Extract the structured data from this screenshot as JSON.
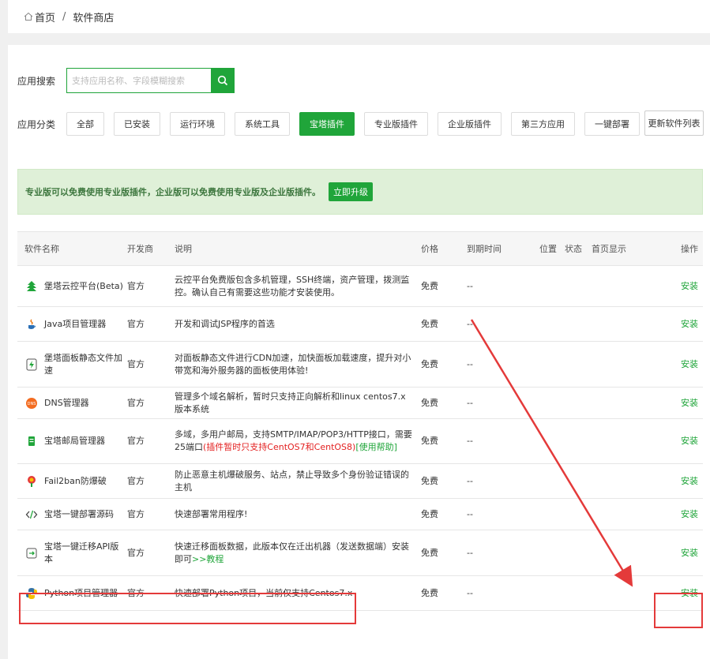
{
  "breadcrumb": {
    "home": "首页",
    "separator": "/",
    "current": "软件商店"
  },
  "search": {
    "label": "应用搜索",
    "placeholder": "支持应用名称、字段模糊搜索"
  },
  "category": {
    "label": "应用分类",
    "buttons": [
      "全部",
      "已安装",
      "运行环境",
      "系统工具",
      "宝塔插件",
      "专业版插件",
      "企业版插件",
      "第三方应用",
      "一键部署"
    ],
    "active": "宝塔插件",
    "refresh": "更新软件列表"
  },
  "promo": {
    "text": "专业版可以免费使用专业版插件，企业版可以免费使用专业版及企业版插件。",
    "upgrade": "立即升级"
  },
  "table": {
    "headers": {
      "name": "软件名称",
      "dev": "开发商",
      "desc": "说明",
      "price": "价格",
      "expire": "到期时间",
      "position": "位置",
      "status": "状态",
      "home": "首页显示",
      "op": "操作"
    },
    "rows": [
      {
        "name": "堡塔云控平台(Beta)",
        "dev": "官方",
        "desc": "云控平台免费版包含多机管理，SSH终端，资产管理，拨测监控。确认自己有需要这些功能才安装使用。",
        "price": "免费",
        "expire": "--",
        "op": "安装",
        "icon": "tree-icon"
      },
      {
        "name": "Java项目管理器",
        "dev": "官方",
        "desc": "开发和调试JSP程序的首选",
        "price": "免费",
        "expire": "--",
        "op": "安装",
        "icon": "java-icon"
      },
      {
        "name": "堡塔面板静态文件加速",
        "dev": "官方",
        "desc": "对面板静态文件进行CDN加速，加快面板加载速度，提升对小带宽和海外服务器的面板使用体验!",
        "price": "免费",
        "expire": "--",
        "op": "安装",
        "icon": "lightning-icon"
      },
      {
        "name": "DNS管理器",
        "dev": "官方",
        "desc": "管理多个域名解析，暂时只支持正向解析和linux centos7.x版本系统",
        "price": "免费",
        "expire": "--",
        "op": "安装",
        "icon": "dns-icon"
      },
      {
        "name": "宝塔邮局管理器",
        "dev": "官方",
        "desc": "多域，多用户邮局，支持SMTP/IMAP/POP3/HTTP接口，需要25端口",
        "desc_red": "(插件暂时只支持CentOS7和CentOS8)",
        "desc_link": "[使用帮助]",
        "price": "免费",
        "expire": "--",
        "op": "安装",
        "icon": "mail-server-icon"
      },
      {
        "name": "Fail2ban防爆破",
        "dev": "官方",
        "desc": "防止恶意主机爆破服务、站点，禁止导致多个身份验证错误的主机",
        "price": "免费",
        "expire": "--",
        "op": "安装",
        "icon": "shield-icon"
      },
      {
        "name": "宝塔一键部署源码",
        "dev": "官方",
        "desc": "快速部署常用程序!",
        "price": "免费",
        "expire": "--",
        "op": "安装",
        "icon": "code-icon"
      },
      {
        "name": "宝塔一键迁移API版本",
        "dev": "官方",
        "desc": "快速迁移面板数据，此版本仅在迁出机器（发送数据端）安装即可",
        "desc_link": ">>教程",
        "price": "免费",
        "expire": "--",
        "op": "安装",
        "icon": "migrate-icon"
      },
      {
        "name": "Python项目管理器",
        "dev": "官方",
        "desc": "快速部署Python项目，当前仅支持Centos7.x",
        "price": "免费",
        "expire": "--",
        "op": "安装",
        "icon": "python-icon"
      }
    ]
  },
  "colors": {
    "accent": "#20a53a",
    "highlight": "#e43a3a"
  }
}
